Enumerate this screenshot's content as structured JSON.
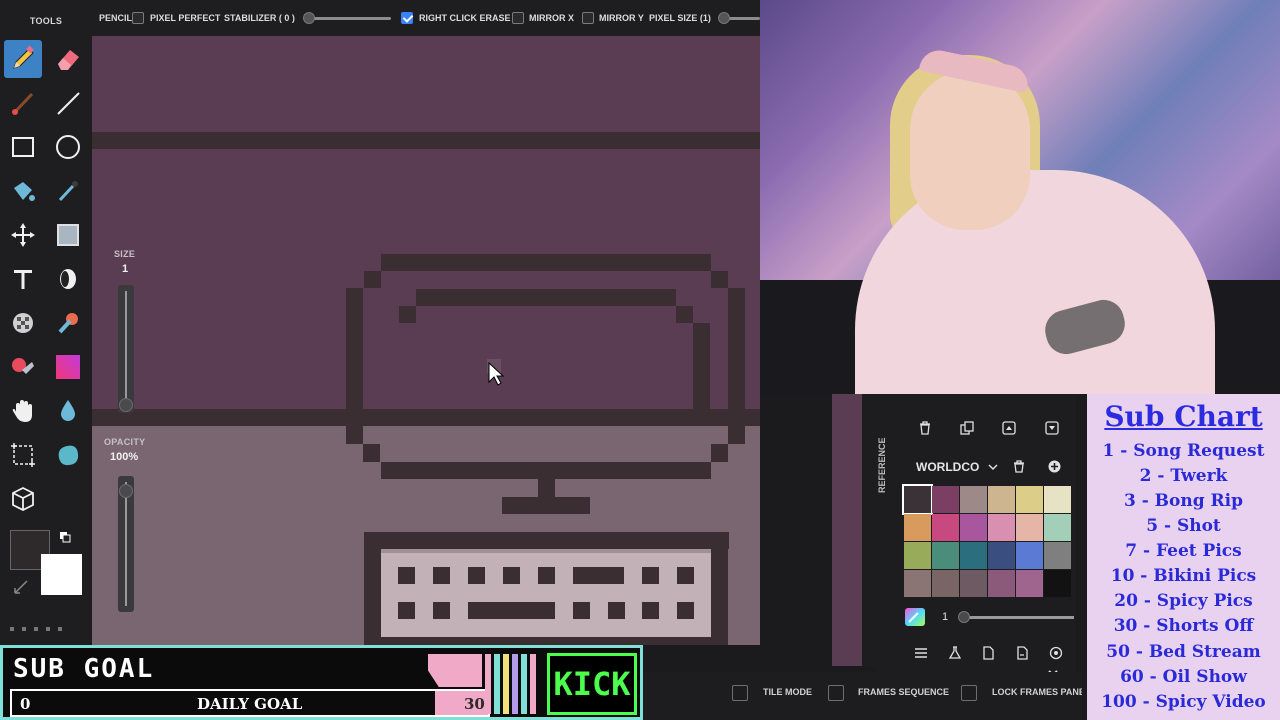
{
  "sidebar": {
    "title": "TOOLS",
    "tools": [
      {
        "name": "pencil-icon",
        "active": true
      },
      {
        "name": "eraser-icon"
      },
      {
        "name": "brush-icon"
      },
      {
        "name": "line-icon"
      },
      {
        "name": "rectangle-icon"
      },
      {
        "name": "ellipse-icon"
      },
      {
        "name": "fill-bucket-icon"
      },
      {
        "name": "eyedropper-icon"
      },
      {
        "name": "move-icon"
      },
      {
        "name": "shape-icon"
      },
      {
        "name": "text-icon"
      },
      {
        "name": "dither-icon"
      },
      {
        "name": "checker-icon"
      },
      {
        "name": "stamp-icon"
      },
      {
        "name": "color-replace-icon"
      },
      {
        "name": "gradient-icon"
      },
      {
        "name": "hand-icon"
      },
      {
        "name": "droplet-icon"
      },
      {
        "name": "select-icon"
      },
      {
        "name": "blob-icon"
      },
      {
        "name": "cube-icon"
      }
    ],
    "size_label": "SIZE",
    "size_value": "1",
    "opacity_label": "OPACITY",
    "opacity_value": "100%",
    "primary_color": "#2e2a2b",
    "secondary_color": "#ffffff"
  },
  "options": {
    "tool": "PENCIL:",
    "pixel_perfect": {
      "label": "PIXEL PERFECT",
      "checked": false
    },
    "stabilizer": "STABILIZER ( 0 )",
    "right_click_erase": {
      "label": "RIGHT CLICK ERASE",
      "checked": true
    },
    "mirror_x": {
      "label": "MIRROR X",
      "checked": false
    },
    "mirror_y": {
      "label": "MIRROR Y",
      "checked": false
    },
    "pixel_size": "PIXEL SIZE (1)"
  },
  "canvas": {
    "bg_color": "#5a3d52",
    "desk_color": "#7a6670",
    "line_color": "#3a2e33"
  },
  "right_panel": {
    "reference_label": "REFERENCE",
    "palette_name": "WORLDCO",
    "palette_count": "1",
    "swatches": [
      "#3a3236",
      "#7b3f64",
      "#9e8989",
      "#cdb58f",
      "#dccd89",
      "#e8e2c4",
      "#d99a5e",
      "#c7497f",
      "#a8579f",
      "#d98fb0",
      "#e5b5a7",
      "#a3cfb8",
      "#97ab5b",
      "#4a8d7a",
      "#2b6e7d",
      "#3a4f7f",
      "#5a7ad4",
      "#7f7f7f",
      "#8a7574",
      "#7a6565",
      "#6d5a63",
      "#8b5a7a",
      "#a0658f",
      "#121212"
    ]
  },
  "bottom_bar": {
    "tile_mode": "TILE MODE",
    "frames_sequence": "FRAMES SEQUENCE",
    "lock_frames": "LOCK FRAMES PANEL"
  },
  "sub_chart": {
    "title": "Sub Chart",
    "items": [
      "1 - Song Request",
      "2 - Twerk",
      "3 - Bong Rip",
      "5 - Shot",
      "7 - Feet Pics",
      "10 - Bikini Pics",
      "20 - Spicy Pics",
      "30 - Shorts Off",
      "50 - Bed Stream",
      "60 - Oil Show",
      "100 - Spicy Video"
    ]
  },
  "sub_goal": {
    "title": "SUB GOAL",
    "current": "0",
    "label": "DAILY GOAL",
    "target": "30",
    "progress_fraction": 0,
    "kick_label": "KICK",
    "stripes": [
      "#f0a9c6",
      "#7ee0d6",
      "#f2e07a",
      "#b49ae8",
      "#7ee0d6",
      "#f0a9c6"
    ]
  }
}
